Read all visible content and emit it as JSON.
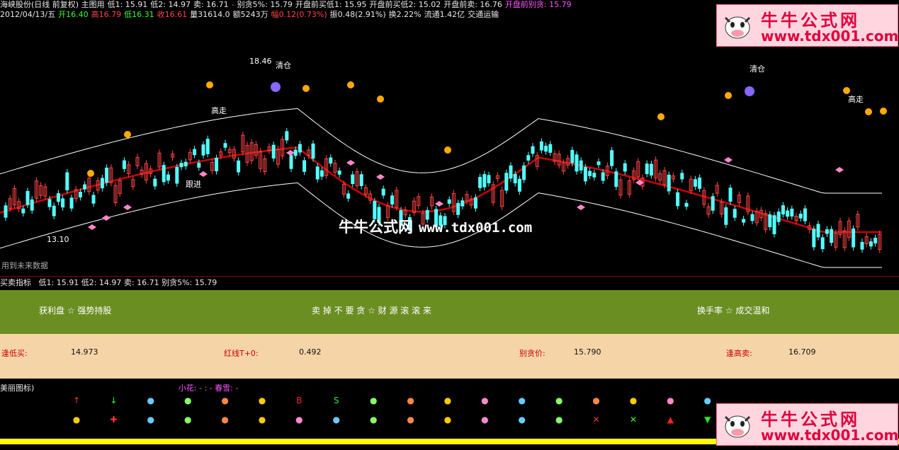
{
  "header_line1": [
    {
      "text": "海峡股份(日线 前复权) 主图用",
      "color": "w"
    },
    {
      "text": "低1: 15.91",
      "color": "w"
    },
    {
      "text": "低2: 14.97",
      "color": "w"
    },
    {
      "text": "卖: 16.71",
      "color": "w"
    },
    {
      "text": "-",
      "color": "r"
    },
    {
      "text": "别贪5%: 15.79",
      "color": "w"
    },
    {
      "text": "开盘前买低1: 15.95",
      "color": "w"
    },
    {
      "text": "开盘前买低2: 15.02",
      "color": "w"
    },
    {
      "text": "开盘前卖: 16.76",
      "color": "w"
    },
    {
      "text": "开盘前别贪: 15.79",
      "color": "m"
    }
  ],
  "header_line2": [
    {
      "text": "2012/04/13/五",
      "color": "w"
    },
    {
      "text": "开16.40",
      "color": "g"
    },
    {
      "text": "高16.79",
      "color": "r"
    },
    {
      "text": "低16.31",
      "color": "g"
    },
    {
      "text": "收16.61",
      "color": "r"
    },
    {
      "text": "量31614.0",
      "color": "w"
    },
    {
      "text": "额5243万",
      "color": "w"
    },
    {
      "text": "幅0.12(0.73%)",
      "color": "r"
    },
    {
      "text": "振0.48(2.91%)",
      "color": "w"
    },
    {
      "text": "换2.22%",
      "color": "w"
    },
    {
      "text": "流通1.42亿",
      "color": "w"
    },
    {
      "text": "交通运输",
      "color": "w"
    }
  ],
  "annotations": {
    "high_price": "18.46",
    "low_price": "13.10",
    "clear1": "清仓",
    "clear2": "清仓",
    "go_high1": "高走",
    "go_high2": "高走",
    "follow": "跟进",
    "future_data": "用到未来数据"
  },
  "watermark": {
    "cn": "牛牛公式网",
    "url": "www.tdx001.com"
  },
  "logo": {
    "cn": "牛牛公式网",
    "url": "www.tdx001.com"
  },
  "indicator": {
    "title": "买卖指标",
    "items": [
      "低1: 15.91",
      "低2: 14.97",
      "卖: 16.71",
      "别贪5%: 15.79"
    ]
  },
  "green_band": [
    "获利盘 ☆ 强势持股",
    "卖 掉 不 要 贪 ☆ 财 源 滚 滚 来",
    "换手率 ☆ 成交温和"
  ],
  "peach_band": [
    {
      "label": "逢低买:",
      "value": "14.973"
    },
    {
      "label": "红线T+0:",
      "value": "0.492"
    },
    {
      "label": "别贪价:",
      "value": "15.790"
    },
    {
      "label": "逢高卖:",
      "value": "16.709"
    }
  ],
  "icons_panel": {
    "title": "美丽图标)",
    "subtitle": "小花: -  : - 春雪: -"
  },
  "icons_row1": [
    "arrow-up-icon",
    "arrow-down-icon",
    "cry-face-icon",
    "sad-face-icon",
    "smile-face-icon",
    "purple-face-icon",
    "letter-b-icon",
    "letter-s-icon",
    "money-bag-icon",
    "treasure-chest-icon",
    "hand-icon",
    "mushroom-icon",
    "red-ball-icon",
    "blue-ball-icon",
    "runner-icon",
    "green-apple-icon",
    "orange-icon",
    "cherries-icon"
  ],
  "icons_row2": [
    "cake-icon",
    "plus-circle-icon",
    "diamond-blue-icon",
    "diamond-pink-icon",
    "diamond-gold-icon",
    "diamond-green-icon",
    "bat-blue-icon",
    "bat-green-icon",
    "bat-purple-icon",
    "dragon-gold-icon",
    "dragon-red-icon",
    "dragon-pink-icon",
    "up-circle-icon",
    "down-circle-icon",
    "cross-red-icon",
    "cross-green-icon",
    "triangle-up-icon",
    "triangle-down-icon"
  ],
  "colors": {
    "up": "#ff4444",
    "down": "#55ffff",
    "mid_line": "#cc0000",
    "band_line": "#ffffff",
    "green_band": "#6b8e23",
    "peach_band": "#f5d5a8"
  }
}
